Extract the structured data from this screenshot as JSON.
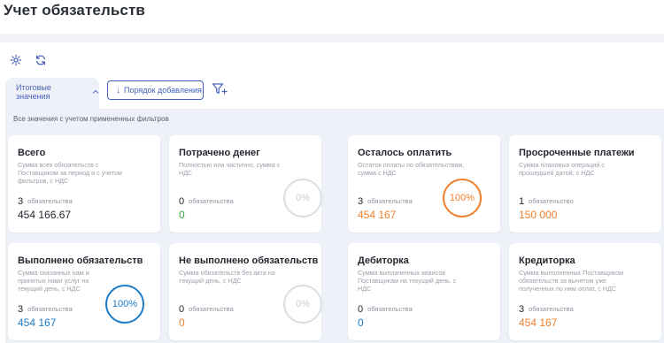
{
  "page": {
    "title": "Учет обязательств"
  },
  "toolbar": {
    "settings_icon": "gear-icon",
    "refresh_icon": "refresh-icon",
    "tab_label": "Итоговые значения",
    "order_button_label": "Порядок добавления",
    "filter_icon": "filter-add-icon"
  },
  "content": {
    "caption": "Все значения с учетом примененных фильтров"
  },
  "cards": [
    {
      "title": "Всего",
      "description": "Сумма всех обязательств с Поставщиком за период и с учетом фильтров, с НДС",
      "count": "3",
      "unit": "обязательства",
      "sum": "454 166.67"
    },
    {
      "title": "Потрачено денег",
      "description": "Полностью или частично, сумма с НДС",
      "count": "0",
      "unit": "обязательства",
      "sum": "0",
      "percent": "0%"
    },
    {
      "title": "Осталось оплатить",
      "description": "Остаток оплаты по обязательствам, сумма с НДС",
      "count": "3",
      "unit": "обязательства",
      "sum": "454 167",
      "percent": "100%"
    },
    {
      "title": "Просроченные платежи",
      "description": "Сумма плановых операций с прошедшей датой, с НДС",
      "count": "1",
      "unit": "обязательство",
      "sum": "150 000"
    },
    {
      "title": "Выполнено обязательств",
      "description": "Сумма оказанных нам и принятых нами услуг на текущий день, с НДС",
      "count": "3",
      "unit": "обязательства",
      "sum": "454 167",
      "percent": "100%"
    },
    {
      "title": "Не выполнено обязательств",
      "description": "Сумма обязательств без акта на текущий день, с НДС",
      "count": "0",
      "unit": "обязательства",
      "sum": "0",
      "percent": "0%"
    },
    {
      "title": "Дебиторка",
      "description": "Сумма выплаченных авансов Поставщикам на текущий день, с НДС",
      "count": "0",
      "unit": "обязательства",
      "sum": "0"
    },
    {
      "title": "Кредиторка",
      "description": "Сумма выполненных Поставщиком обязательств за вычетом уже полученных по ним оплат, с НДС",
      "count": "3",
      "unit": "обязательства",
      "sum": "454 167"
    }
  ]
}
